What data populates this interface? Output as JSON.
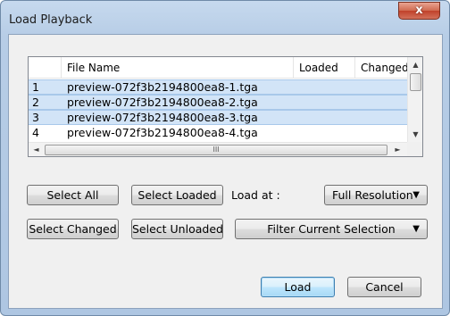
{
  "window": {
    "title": "Load Playback",
    "close_glyph": "x"
  },
  "table": {
    "columns": [
      {
        "label": ""
      },
      {
        "label": "File Name"
      },
      {
        "label": "Loaded"
      },
      {
        "label": "Changed"
      }
    ],
    "rows": [
      {
        "num": "1",
        "name": "preview-072f3b2194800ea8-1.tga",
        "selected": true
      },
      {
        "num": "2",
        "name": "preview-072f3b2194800ea8-2.tga",
        "selected": true
      },
      {
        "num": "3",
        "name": "preview-072f3b2194800ea8-3.tga",
        "selected": true
      },
      {
        "num": "4",
        "name": "preview-072f3b2194800ea8-4.tga",
        "selected": false
      }
    ]
  },
  "scroll": {
    "up": "▲",
    "down": "▼",
    "left": "◄",
    "right": "►",
    "thumb_grip": "III"
  },
  "buttons": {
    "select_all": "Select All",
    "select_loaded": "Select Loaded",
    "select_changed": "Select Changed",
    "select_unloaded": "Select Unloaded",
    "load": "Load",
    "cancel": "Cancel"
  },
  "load_at": {
    "label": "Load at :",
    "value": "Full Resolution",
    "arrow": "▼"
  },
  "filter": {
    "value": "Filter Current Selection",
    "arrow": "▼"
  },
  "colors": {
    "selection": "#d2e4f7",
    "titlebar": "#b7cde6",
    "close": "#c0412a"
  }
}
